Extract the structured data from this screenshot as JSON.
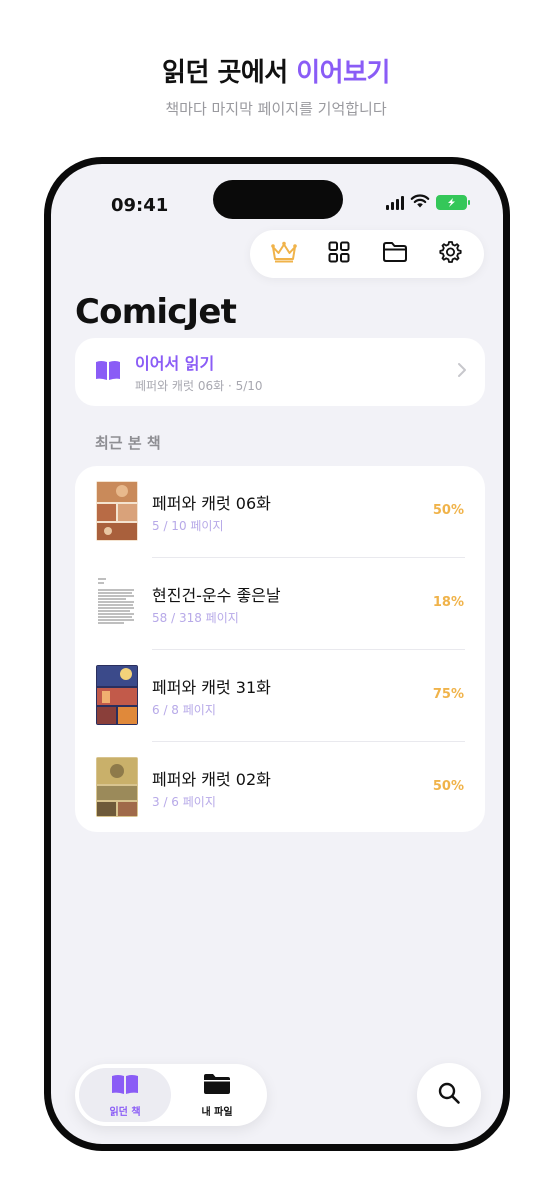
{
  "promo": {
    "headline_prefix": "읽던 곳에서 ",
    "headline_accent": "이어보기",
    "subline": "책마다 마지막 페이지를 기억합니다"
  },
  "status_bar": {
    "time": "09:41"
  },
  "toolbar": {
    "icons": [
      "crown-icon",
      "grid-icon",
      "folder-icon",
      "gear-icon"
    ]
  },
  "app": {
    "title": "ComicJet"
  },
  "resume": {
    "title": "이어서 읽기",
    "subtitle": "페퍼와 캐럿 06화 · 5/10"
  },
  "recent": {
    "section_label": "최근 본 책",
    "items": [
      {
        "title": "페퍼와 캐럿 06화",
        "pages": "5 / 10 페이지",
        "percent": "50%",
        "progress": 0.5
      },
      {
        "title": "현진건-운수 좋은날",
        "pages": "58 / 318 페이지",
        "percent": "18%",
        "progress": 0.18
      },
      {
        "title": "페퍼와 캐럿 31화",
        "pages": "6 / 8 페이지",
        "percent": "75%",
        "progress": 0.75
      },
      {
        "title": "페퍼와 캐럿 02화",
        "pages": "3 / 6 페이지",
        "percent": "50%",
        "progress": 0.5
      }
    ]
  },
  "tabbar": {
    "tabs": [
      {
        "label": "읽던 책",
        "active": true
      },
      {
        "label": "내 파일",
        "active": false
      }
    ]
  },
  "colors": {
    "accent": "#8a5cf6",
    "percent": "#f0b34a",
    "background": "#f2f2f7"
  }
}
